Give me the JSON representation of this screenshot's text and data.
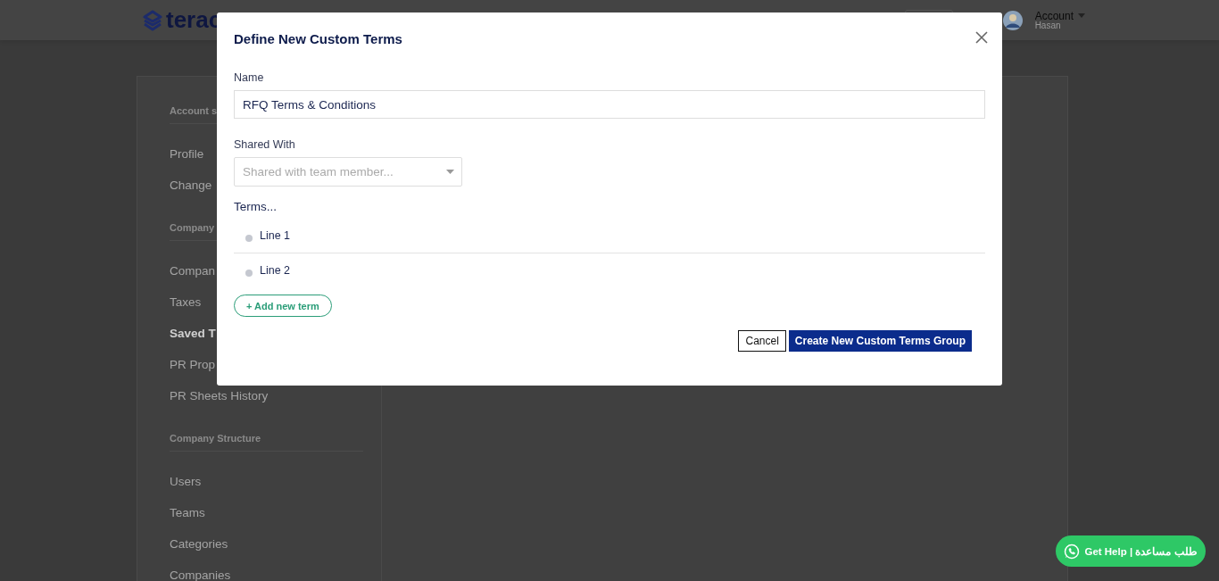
{
  "header": {
    "logo_text": "terac",
    "account": {
      "label": "Account",
      "user": "Hasan"
    }
  },
  "sidebar": {
    "sections": [
      {
        "heading": "Account s",
        "items": [
          {
            "label": "Profile",
            "selected": false
          },
          {
            "label": "Change",
            "selected": false
          }
        ]
      },
      {
        "heading": "Company",
        "items": [
          {
            "label": "Compan",
            "selected": false
          },
          {
            "label": "Taxes",
            "selected": false
          },
          {
            "label": "Saved T",
            "selected": true
          },
          {
            "label": "PR Prop",
            "selected": false
          },
          {
            "label": "PR Sheets History",
            "selected": false
          }
        ]
      },
      {
        "heading": "Company Structure",
        "items": [
          {
            "label": "Users",
            "selected": false
          },
          {
            "label": "Teams",
            "selected": false
          },
          {
            "label": "Categories",
            "selected": false
          },
          {
            "label": "Companies",
            "selected": false
          }
        ]
      }
    ]
  },
  "modal": {
    "title": "Define New Custom Terms",
    "name": {
      "label": "Name",
      "value": "RFQ Terms & Conditions"
    },
    "shared_with": {
      "label": "Shared With",
      "placeholder": "Shared with team member..."
    },
    "terms": {
      "label": "Terms...",
      "lines": [
        "Line 1",
        "Line 2"
      ]
    },
    "add_button": "+ Add new term",
    "buttons": {
      "cancel": "Cancel",
      "create": "Create New Custom Terms Group"
    }
  },
  "help_button": {
    "label": "Get Help | طلب مساعدة"
  }
}
